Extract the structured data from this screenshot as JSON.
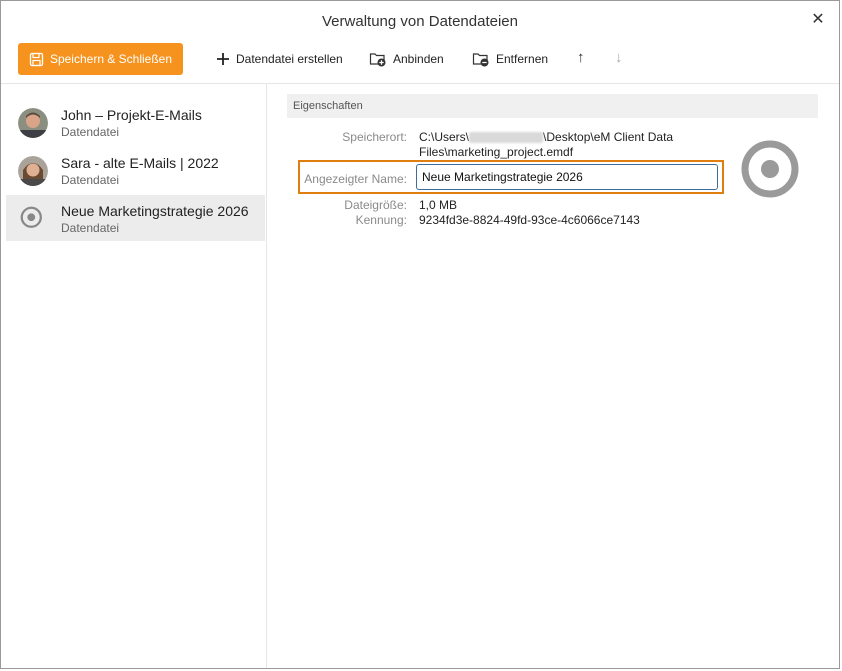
{
  "window": {
    "title": "Verwaltung von Datendateien",
    "close_glyph": "✕"
  },
  "toolbar": {
    "save_label": "Speichern & Schließen",
    "create_label": "Datendatei erstellen",
    "attach_label": "Anbinden",
    "remove_label": "Entfernen",
    "up_glyph": "↑",
    "down_glyph": "↓",
    "accent_color": "#f5931e"
  },
  "sidebar": {
    "items": [
      {
        "title": "John – Projekt-E-Mails",
        "subtitle": "Datendatei",
        "icon": "avatar"
      },
      {
        "title": "Sara - alte E-Mails | 2022",
        "subtitle": "Datendatei",
        "icon": "avatar"
      },
      {
        "title": "Neue Marketingstrategie 2026",
        "subtitle": "Datendatei",
        "icon": "target-icon",
        "selected": true
      }
    ]
  },
  "properties": {
    "header": "Eigenschaften",
    "location_label": "Speicherort:",
    "location_prefix": "C:\\Users\\",
    "location_suffix": "\\Desktop\\eM Client Data",
    "location_line2": "Files\\marketing_project.emdf",
    "display_name_label": "Angezeigter Name:",
    "display_name_value": "Neue Marketingstrategie 2026",
    "size_label": "Dateigröße:",
    "size_value": "1,0 MB",
    "id_label": "Kennung:",
    "id_value": "9234fd3e-8824-49fd-93ce-4c6066ce7143",
    "highlight_color": "#e07f10"
  }
}
